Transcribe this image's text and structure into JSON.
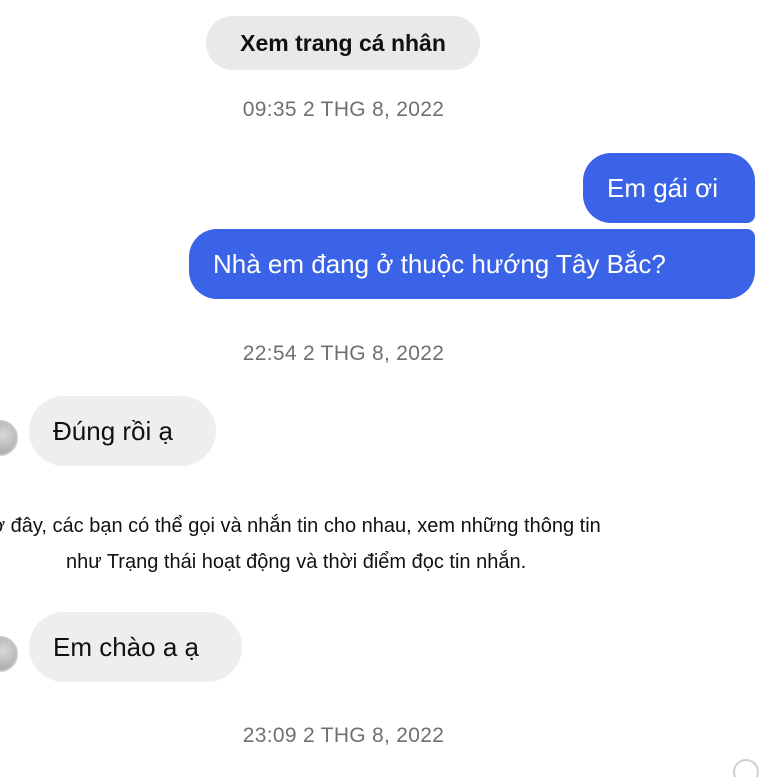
{
  "thread": {
    "profile_button_label": "Xem trang cá nhân",
    "timestamps": {
      "t1": "09:35 2 THG 8, 2022",
      "t2": "22:54 2 THG 8, 2022",
      "t3": "23:09 2 THG 8, 2022"
    },
    "messages": {
      "out1": "Em gái ơi",
      "out2": "Nhà em đang ở thuộc hướng Tây Bắc?",
      "in1": "Đúng rồi ạ",
      "in2": "Em chào a ạ"
    },
    "notice": {
      "line1": "ở đây, các bạn có thể gọi và nhắn tin cho nhau, xem những thông tin",
      "line2": "như Trạng thái hoạt động và thời điểm đọc tin nhắn."
    }
  },
  "colors": {
    "outgoing_bubble": "#3b63e8",
    "incoming_bubble": "#eeeef1",
    "pill_background": "#e9e9eb",
    "timestamp_text": "#707070"
  }
}
